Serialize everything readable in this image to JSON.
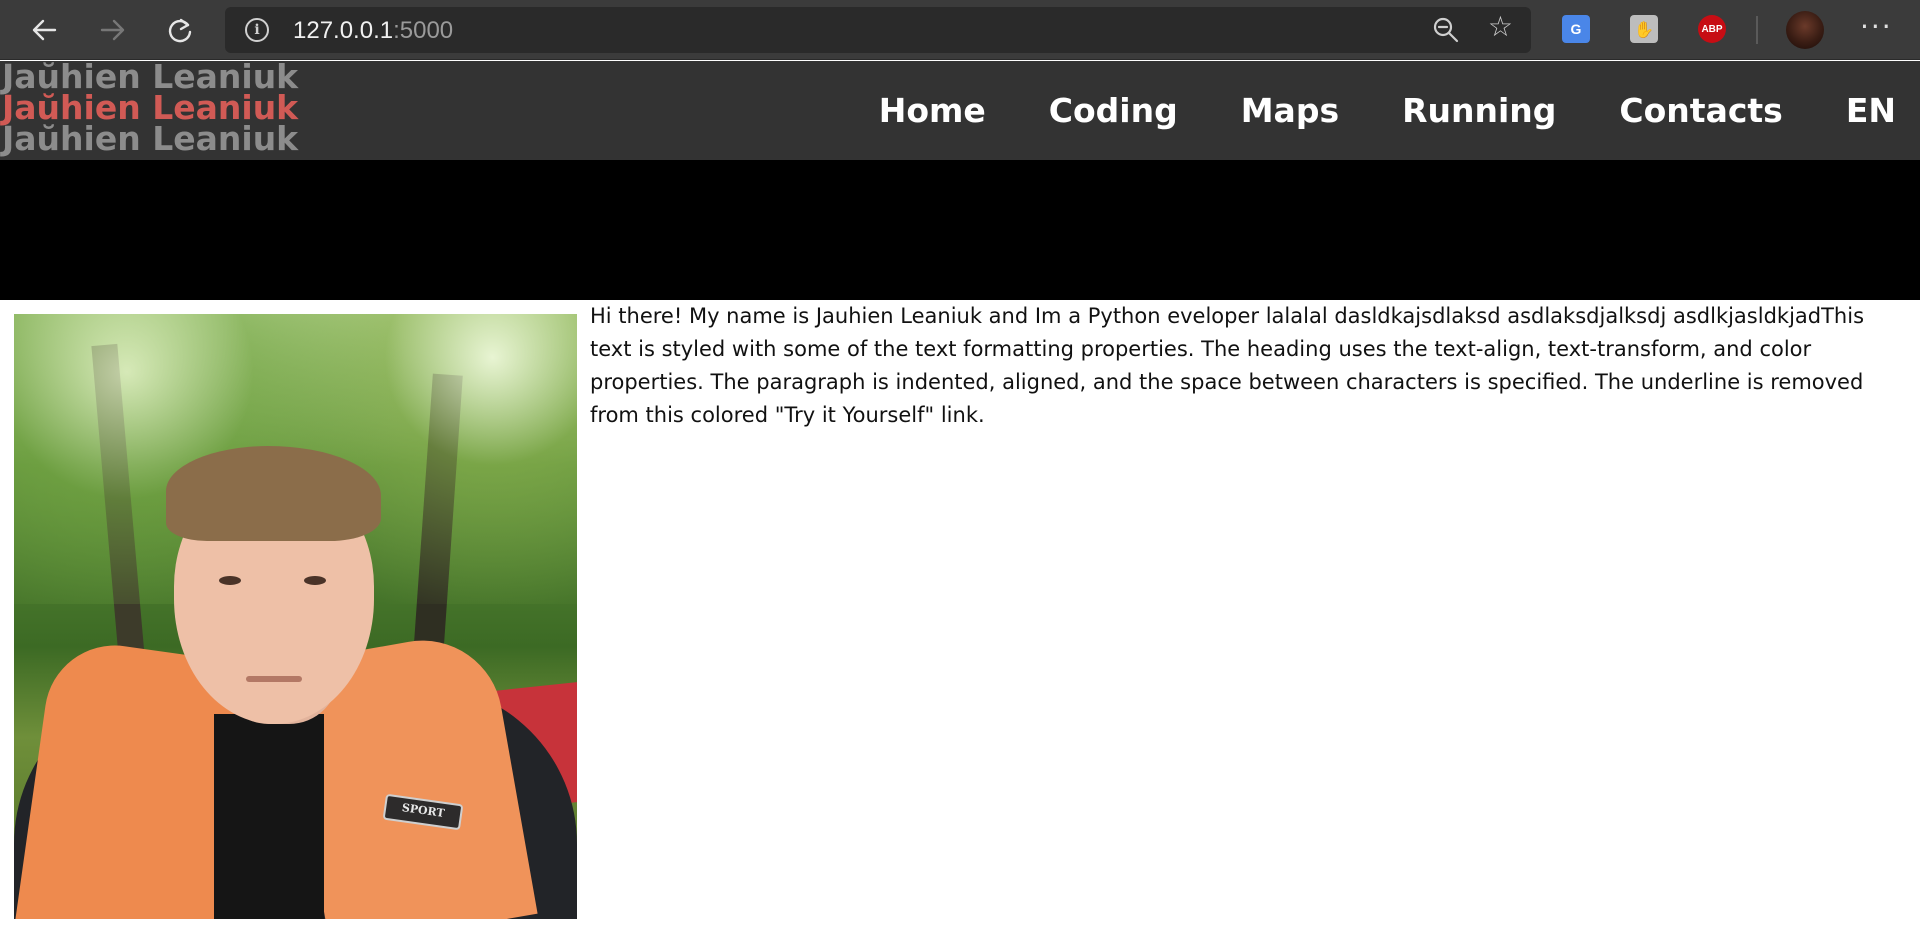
{
  "browser": {
    "url_host": "127.0.0.1",
    "url_port": ":5000",
    "nav_icons": [
      "back-arrow-icon",
      "forward-arrow-icon",
      "reload-icon"
    ],
    "extensions": [
      {
        "name": "google-translate-icon",
        "label": "G"
      },
      {
        "name": "hand-extension-icon",
        "label": ""
      },
      {
        "name": "adblock-plus-icon",
        "label": "ABP"
      }
    ],
    "accent": "#3b3b3b"
  },
  "site": {
    "logo_lines": [
      "Jaŭhien Leaniuk",
      "Jaŭhien Leaniuk",
      "Jaŭhien Leaniuk"
    ],
    "logo_accent_color": "#d15a55",
    "nav": {
      "home": "Home",
      "coding": "Coding",
      "maps": "Maps",
      "running": "Running",
      "contacts": "Contacts",
      "lang": "EN"
    },
    "photo_patch_text": "SPORT",
    "bio": "Hi there! My name is Jauhien Leaniuk and Im a Python eveloper lalalal dasldkajsdlaksd asdlaksdjalksdj asdlkjasldkjadThis text is styled with some of the text formatting properties. The heading uses the text-align, text-transform, and color properties. The paragraph is indented, aligned, and the space between characters is specified. The underline is removed from this colored \"Try it Yourself\" link."
  }
}
